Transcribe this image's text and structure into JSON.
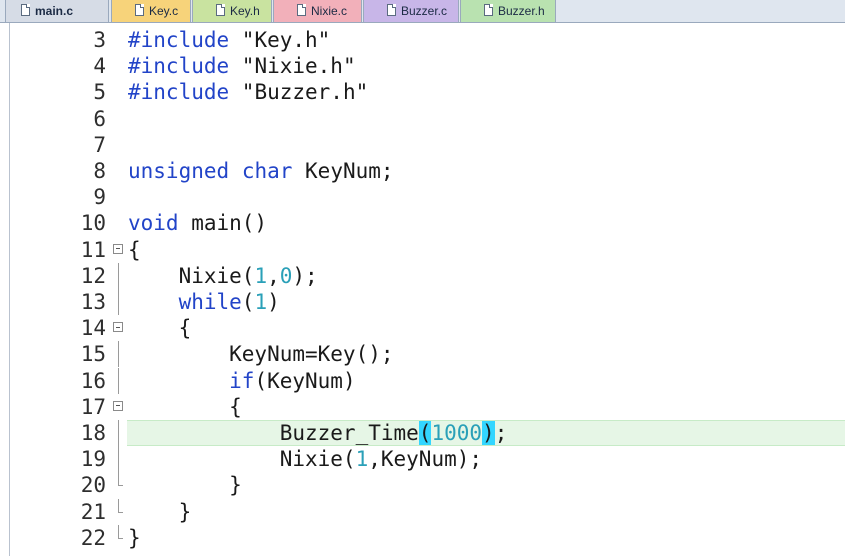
{
  "tabs": [
    {
      "label": "main.c",
      "color": "#d6dce6",
      "active": true
    },
    {
      "label": "Key.c",
      "color": "#f7d37a",
      "active": false
    },
    {
      "label": "Key.h",
      "color": "#c9e3a0",
      "active": false
    },
    {
      "label": "Nixie.c",
      "color": "#f2b0ba",
      "active": false
    },
    {
      "label": "Buzzer.c",
      "color": "#c8b6e8",
      "active": false
    },
    {
      "label": "Buzzer.h",
      "color": "#b9e2b0",
      "active": false
    }
  ],
  "editor": {
    "current_line": 18,
    "lines": [
      {
        "num": "3",
        "segments": [
          {
            "t": "#include",
            "c": "pp"
          },
          {
            "t": " \"Key.h\"",
            "c": "str"
          }
        ]
      },
      {
        "num": "4",
        "segments": [
          {
            "t": "#include",
            "c": "pp"
          },
          {
            "t": " \"Nixie.h\"",
            "c": "str"
          }
        ]
      },
      {
        "num": "5",
        "segments": [
          {
            "t": "#include",
            "c": "pp"
          },
          {
            "t": " \"Buzzer.h\"",
            "c": "str"
          }
        ]
      },
      {
        "num": "6",
        "segments": []
      },
      {
        "num": "7",
        "segments": []
      },
      {
        "num": "8",
        "segments": [
          {
            "t": "unsigned",
            "c": "kw"
          },
          {
            "t": " "
          },
          {
            "t": "char",
            "c": "kw"
          },
          {
            "t": " KeyNum;"
          }
        ]
      },
      {
        "num": "9",
        "segments": []
      },
      {
        "num": "10",
        "segments": [
          {
            "t": "void",
            "c": "kw"
          },
          {
            "t": " main()"
          }
        ]
      },
      {
        "num": "11",
        "fold": "open",
        "segments": [
          {
            "t": "{"
          }
        ]
      },
      {
        "num": "12",
        "fold": "line",
        "segments": [
          {
            "t": "    Nixie("
          },
          {
            "t": "1",
            "c": "num"
          },
          {
            "t": ","
          },
          {
            "t": "0",
            "c": "num"
          },
          {
            "t": ");"
          }
        ]
      },
      {
        "num": "13",
        "fold": "line",
        "segments": [
          {
            "t": "    "
          },
          {
            "t": "while",
            "c": "kw"
          },
          {
            "t": "("
          },
          {
            "t": "1",
            "c": "num"
          },
          {
            "t": ")"
          }
        ]
      },
      {
        "num": "14",
        "fold": "open",
        "segments": [
          {
            "t": "    {"
          }
        ]
      },
      {
        "num": "15",
        "fold": "line",
        "segments": [
          {
            "t": "        KeyNum=Key();"
          }
        ]
      },
      {
        "num": "16",
        "fold": "line",
        "segments": [
          {
            "t": "        "
          },
          {
            "t": "if",
            "c": "kw"
          },
          {
            "t": "(KeyNum)"
          }
        ]
      },
      {
        "num": "17",
        "fold": "open",
        "segments": [
          {
            "t": "        {"
          }
        ]
      },
      {
        "num": "18",
        "fold": "line",
        "segments": [
          {
            "t": "            Buzzer_Time"
          },
          {
            "t": "(",
            "c": "match"
          },
          {
            "t": "1000",
            "c": "num"
          },
          {
            "t": ")",
            "c": "match"
          },
          {
            "t": ";"
          }
        ]
      },
      {
        "num": "19",
        "fold": "line",
        "segments": [
          {
            "t": "            Nixie("
          },
          {
            "t": "1",
            "c": "num"
          },
          {
            "t": ",KeyNum);"
          }
        ]
      },
      {
        "num": "20",
        "fold": "end",
        "segments": [
          {
            "t": "        }"
          }
        ]
      },
      {
        "num": "21",
        "fold": "end",
        "segments": [
          {
            "t": "    }"
          }
        ]
      },
      {
        "num": "22",
        "fold": "end",
        "segments": [
          {
            "t": "}"
          }
        ]
      }
    ]
  }
}
